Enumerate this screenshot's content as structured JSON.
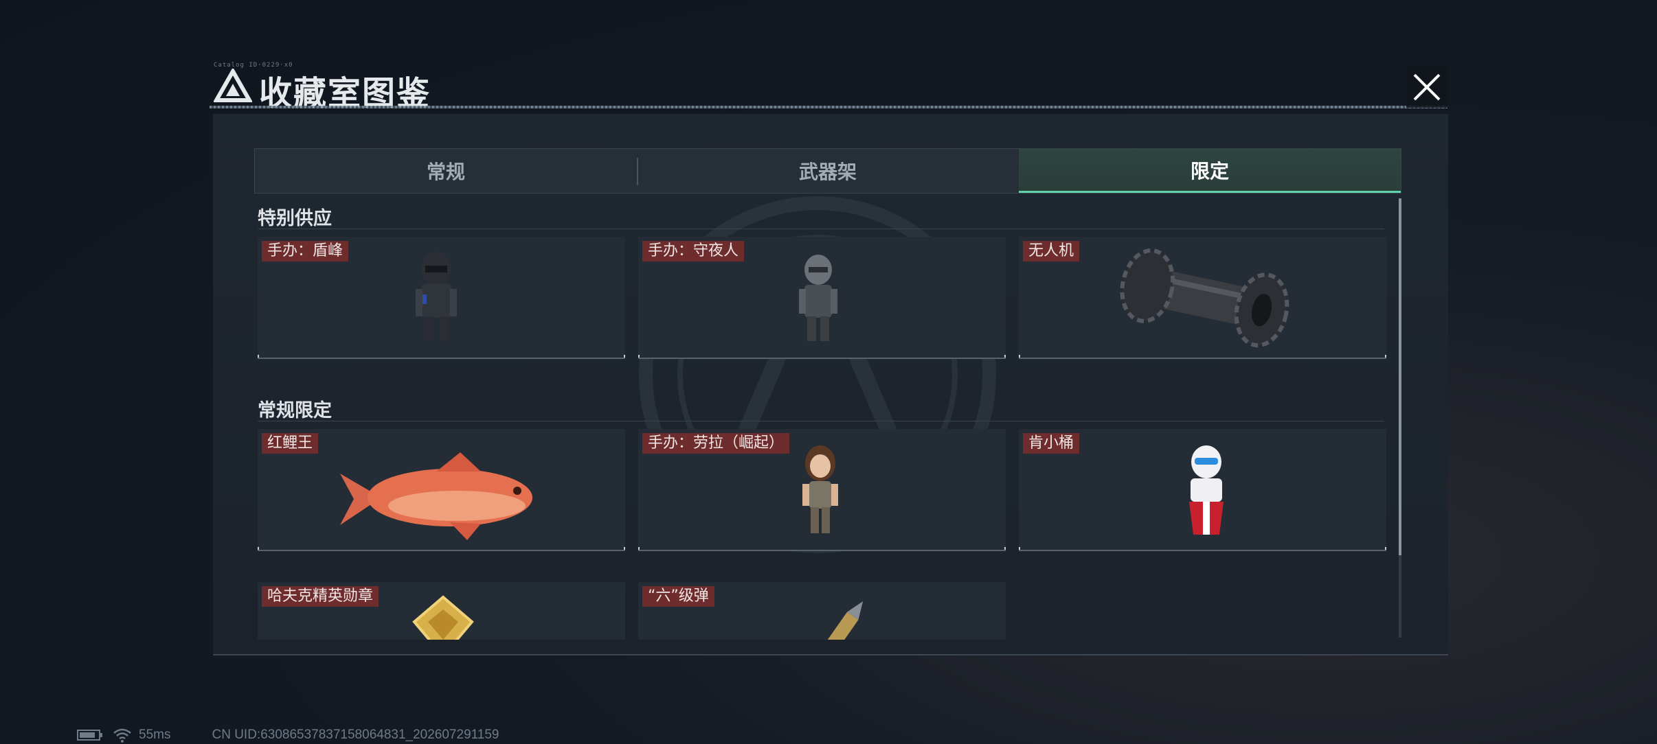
{
  "header": {
    "title": "收藏室图鉴",
    "tiny_text": "Catalog ID·0229·x0"
  },
  "tabs": [
    {
      "label": "常规",
      "active": false
    },
    {
      "label": "武器架",
      "active": false
    },
    {
      "label": "限定",
      "active": true
    }
  ],
  "sections": [
    {
      "title": "特别供应",
      "items": [
        {
          "label": "手办：盾峰",
          "icon": "armored-soldier-figurine-icon"
        },
        {
          "label": "手办：守夜人",
          "icon": "masked-soldier-figurine-icon"
        },
        {
          "label": "无人机",
          "icon": "drone-cylinder-icon"
        }
      ]
    },
    {
      "title": "常规限定",
      "items": [
        {
          "label": "红鲤王",
          "icon": "red-carp-icon"
        },
        {
          "label": "手办：劳拉（崛起）",
          "icon": "lara-figurine-icon"
        },
        {
          "label": "肯小桶",
          "icon": "kfc-bucket-figurine-icon"
        },
        {
          "label": "哈夫克精英勋章",
          "icon": "gold-medal-icon"
        },
        {
          "label": "“六”级弹",
          "icon": "bullet-icon"
        }
      ]
    }
  ],
  "status_bar": {
    "ping": "55ms",
    "uid": "CN UID:63086537837158064831_202607291159",
    "battery_level": 0.85
  },
  "colors": {
    "accent": "#5fd1a7",
    "label_bg": "#6e2c2c",
    "panel_bg": "#1f2730"
  }
}
